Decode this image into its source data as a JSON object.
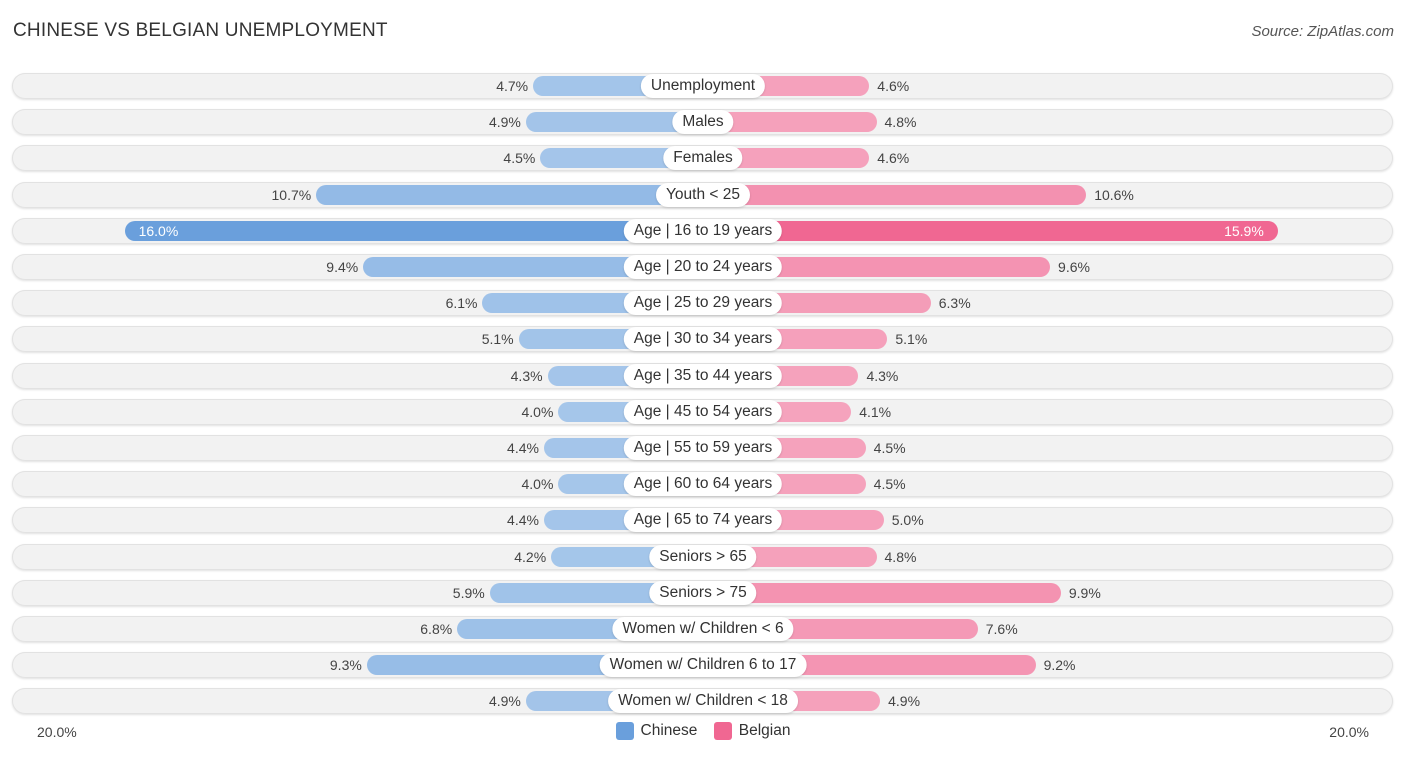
{
  "title": "CHINESE VS BELGIAN UNEMPLOYMENT",
  "source": "Source: ZipAtlas.com",
  "colors": {
    "chinese": "#a5c6ea",
    "chinese_strong": "#6a9fdc",
    "belgian": "#f5a3bd",
    "belgian_strong": "#f06792"
  },
  "chart_data": {
    "type": "bar",
    "orientation": "diverging-horizontal",
    "title": "CHINESE VS BELGIAN UNEMPLOYMENT",
    "categories": [
      "Unemployment",
      "Males",
      "Females",
      "Youth < 25",
      "Age | 16 to 19 years",
      "Age | 20 to 24 years",
      "Age | 25 to 29 years",
      "Age | 30 to 34 years",
      "Age | 35 to 44 years",
      "Age | 45 to 54 years",
      "Age | 55 to 59 years",
      "Age | 60 to 64 years",
      "Age | 65 to 74 years",
      "Seniors > 65",
      "Seniors > 75",
      "Women w/ Children < 6",
      "Women w/ Children 6 to 17",
      "Women w/ Children < 18"
    ],
    "series": [
      {
        "name": "Chinese",
        "side": "left",
        "values": [
          4.7,
          4.9,
          4.5,
          10.7,
          16.0,
          9.4,
          6.1,
          5.1,
          4.3,
          4.0,
          4.4,
          4.0,
          4.4,
          4.2,
          5.9,
          6.8,
          9.3,
          4.9
        ]
      },
      {
        "name": "Belgian",
        "side": "right",
        "values": [
          4.6,
          4.8,
          4.6,
          10.6,
          15.9,
          9.6,
          6.3,
          5.1,
          4.3,
          4.1,
          4.5,
          4.5,
          5.0,
          4.8,
          9.9,
          7.6,
          9.2,
          4.9
        ]
      }
    ],
    "value_suffix": "%",
    "axis_max": 20.0,
    "axis_labels": {
      "left": "20.0%",
      "right": "20.0%"
    },
    "legend": [
      "Chinese",
      "Belgian"
    ],
    "legend_position": "bottom-center",
    "highlight_index": 4
  }
}
